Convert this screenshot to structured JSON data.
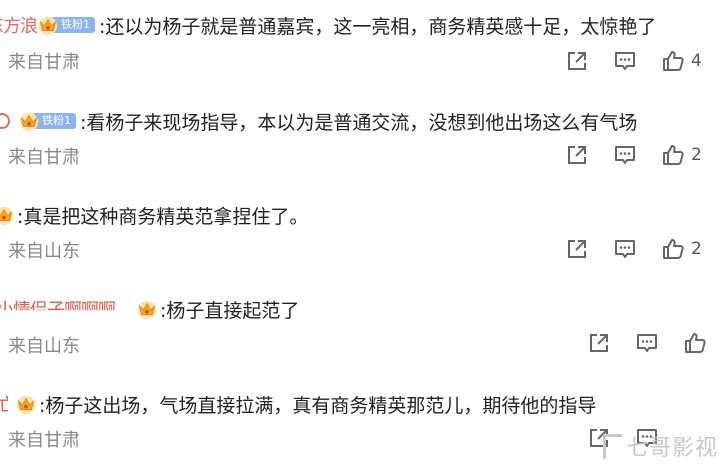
{
  "comments": [
    {
      "username": "东方浪",
      "badge": "铁粉1",
      "text": ":还以为杨子就是普通嘉宾，这一亮相，商务精英感十足，太惊艳了",
      "location": "来自甘肃",
      "likes": "4"
    },
    {
      "username": "",
      "badge": "铁粉1",
      "text": ":看杨子来现场指导，本以为是普通交流，没想到他出场这么有气场",
      "location": "来自甘肃",
      "likes": "2"
    },
    {
      "username": "",
      "badge": "",
      "text": ":真是把这种商务精英范拿捏住了。",
      "location": "来自山东",
      "likes": "2"
    },
    {
      "username": "小情侣子啊啊啊",
      "badge": "",
      "text": ":杨子直接起范了",
      "location": "来自山东",
      "likes": ""
    },
    {
      "username": "",
      "badge": "",
      "text": ":杨子这出场，气场直接拉满，真有商务精英那范儿，期待他的指导",
      "location": "来自甘肃",
      "likes": ""
    }
  ],
  "icons": {
    "share": "share-icon",
    "comment": "comment-icon",
    "like": "thumbs-up-icon",
    "crown": "crown-icon"
  },
  "watermark": "七哥影视",
  "colors": {
    "username": "#e86a5a",
    "badge": "#8ab3f5",
    "crown": "#f5a623",
    "meta": "#888888"
  }
}
